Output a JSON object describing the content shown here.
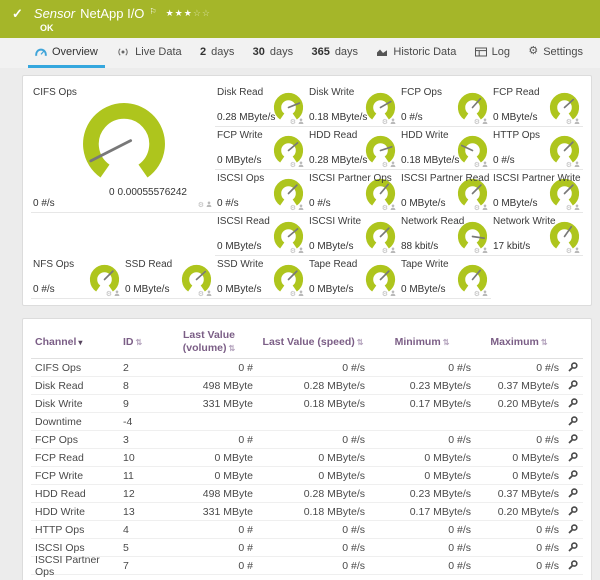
{
  "colors": {
    "header_green": "#a5b629",
    "gauge_green": "#aec51d",
    "active_tab_blue": "#35a7de",
    "table_header_purple": "#7b5e86"
  },
  "header": {
    "check_icon": "✓",
    "object_type": "Sensor",
    "title": "NetApp I/O",
    "flag_icon": "⚐",
    "stars_filled": "★★★",
    "stars_empty": "☆☆",
    "status": "OK"
  },
  "tabs": [
    {
      "label": "Overview",
      "icon": "gauge",
      "active": true
    },
    {
      "label": "Live Data",
      "icon": "live",
      "active": false
    },
    {
      "num": "2",
      "label": "days",
      "active": false
    },
    {
      "num": "30",
      "label": "days",
      "active": false
    },
    {
      "num": "365",
      "label": "days",
      "active": false
    },
    {
      "label": "Historic Data",
      "icon": "chart",
      "active": false
    },
    {
      "label": "Log",
      "icon": "log",
      "active": false
    },
    {
      "label": "Settings",
      "icon": "gear",
      "active": false
    }
  ],
  "gauges": {
    "big": {
      "label": "CIFS Ops",
      "value": "0 #/s",
      "scale_min": "0",
      "scale_max": "0.00055576242",
      "needle_deg": 207
    },
    "small": [
      {
        "label": "Disk Read",
        "value": "0.28 MByte/s",
        "needle_deg": 22,
        "col": 3,
        "row": 1
      },
      {
        "label": "Disk Write",
        "value": "0.18 MByte/s",
        "needle_deg": 30,
        "col": 4,
        "row": 1
      },
      {
        "label": "FCP Ops",
        "value": "0 #/s",
        "needle_deg": 48,
        "col": 5,
        "row": 1
      },
      {
        "label": "FCP Read",
        "value": "0 MByte/s",
        "needle_deg": 42,
        "col": 6,
        "row": 1
      },
      {
        "label": "FCP Write",
        "value": "0 MByte/s",
        "needle_deg": 40,
        "col": 3,
        "row": 2
      },
      {
        "label": "HDD Read",
        "value": "0.28 MByte/s",
        "needle_deg": 18,
        "col": 4,
        "row": 2
      },
      {
        "label": "HDD Write",
        "value": "0.18 MByte/s",
        "needle_deg": 155,
        "col": 5,
        "row": 2
      },
      {
        "label": "HTTP Ops",
        "value": "0 #/s",
        "needle_deg": 45,
        "col": 6,
        "row": 2
      },
      {
        "label": "ISCSI Ops",
        "value": "0 #/s",
        "needle_deg": 45,
        "col": 3,
        "row": 3
      },
      {
        "label": "ISCSI Partner Ops",
        "value": "0 #/s",
        "needle_deg": 50,
        "col": 4,
        "row": 3
      },
      {
        "label": "ISCSI Partner Read",
        "value": "0 MByte/s",
        "needle_deg": 45,
        "col": 5,
        "row": 3
      },
      {
        "label": "ISCSI Partner Write",
        "value": "0 MByte/s",
        "needle_deg": 45,
        "col": 6,
        "row": 3
      },
      {
        "label": "ISCSI Read",
        "value": "0 MByte/s",
        "needle_deg": 40,
        "col": 3,
        "row": 4
      },
      {
        "label": "ISCSI Write",
        "value": "0 MByte/s",
        "needle_deg": 45,
        "col": 4,
        "row": 4
      },
      {
        "label": "Network Read",
        "value": "88 kbit/s",
        "needle_deg": -8,
        "col": 5,
        "row": 4
      },
      {
        "label": "Network Write",
        "value": "17 kbit/s",
        "needle_deg": 55,
        "col": 6,
        "row": 4
      },
      {
        "label": "NFS Ops",
        "value": "0 #/s",
        "needle_deg": 45,
        "col": 1,
        "row": 5
      },
      {
        "label": "SSD Read",
        "value": "0 MByte/s",
        "needle_deg": 42,
        "col": 2,
        "row": 5
      },
      {
        "label": "SSD Write",
        "value": "0 MByte/s",
        "needle_deg": 45,
        "col": 3,
        "row": 5
      },
      {
        "label": "Tape Read",
        "value": "0 MByte/s",
        "needle_deg": 45,
        "col": 4,
        "row": 5
      },
      {
        "label": "Tape Write",
        "value": "0 MByte/s",
        "needle_deg": 50,
        "col": 5,
        "row": 5
      }
    ]
  },
  "table": {
    "columns": {
      "channel": "Channel",
      "id": "ID",
      "volume": "Last Value (volume)",
      "speed": "Last Value (speed)",
      "min": "Minimum",
      "max": "Maximum"
    },
    "rows": [
      {
        "channel": "CIFS Ops",
        "id": "2",
        "volume": "0 #",
        "speed": "0 #/s",
        "min": "0 #/s",
        "max": "0 #/s"
      },
      {
        "channel": "Disk Read",
        "id": "8",
        "volume": "498 MByte",
        "speed": "0.28 MByte/s",
        "min": "0.23 MByte/s",
        "max": "0.37 MByte/s"
      },
      {
        "channel": "Disk Write",
        "id": "9",
        "volume": "331 MByte",
        "speed": "0.18 MByte/s",
        "min": "0.17 MByte/s",
        "max": "0.20 MByte/s"
      },
      {
        "channel": "Downtime",
        "id": "-4",
        "volume": "",
        "speed": "",
        "min": "",
        "max": ""
      },
      {
        "channel": "FCP Ops",
        "id": "3",
        "volume": "0 #",
        "speed": "0 #/s",
        "min": "0 #/s",
        "max": "0 #/s"
      },
      {
        "channel": "FCP Read",
        "id": "10",
        "volume": "0 MByte",
        "speed": "0 MByte/s",
        "min": "0 MByte/s",
        "max": "0 MByte/s"
      },
      {
        "channel": "FCP Write",
        "id": "11",
        "volume": "0 MByte",
        "speed": "0 MByte/s",
        "min": "0 MByte/s",
        "max": "0 MByte/s"
      },
      {
        "channel": "HDD Read",
        "id": "12",
        "volume": "498 MByte",
        "speed": "0.28 MByte/s",
        "min": "0.23 MByte/s",
        "max": "0.37 MByte/s"
      },
      {
        "channel": "HDD Write",
        "id": "13",
        "volume": "331 MByte",
        "speed": "0.18 MByte/s",
        "min": "0.17 MByte/s",
        "max": "0.20 MByte/s"
      },
      {
        "channel": "HTTP Ops",
        "id": "4",
        "volume": "0 #",
        "speed": "0 #/s",
        "min": "0 #/s",
        "max": "0 #/s"
      },
      {
        "channel": "ISCSI Ops",
        "id": "5",
        "volume": "0 #",
        "speed": "0 #/s",
        "min": "0 #/s",
        "max": "0 #/s"
      },
      {
        "channel": "ISCSI Partner Ops",
        "id": "7",
        "volume": "0 #",
        "speed": "0 #/s",
        "min": "0 #/s",
        "max": "0 #/s"
      }
    ]
  }
}
